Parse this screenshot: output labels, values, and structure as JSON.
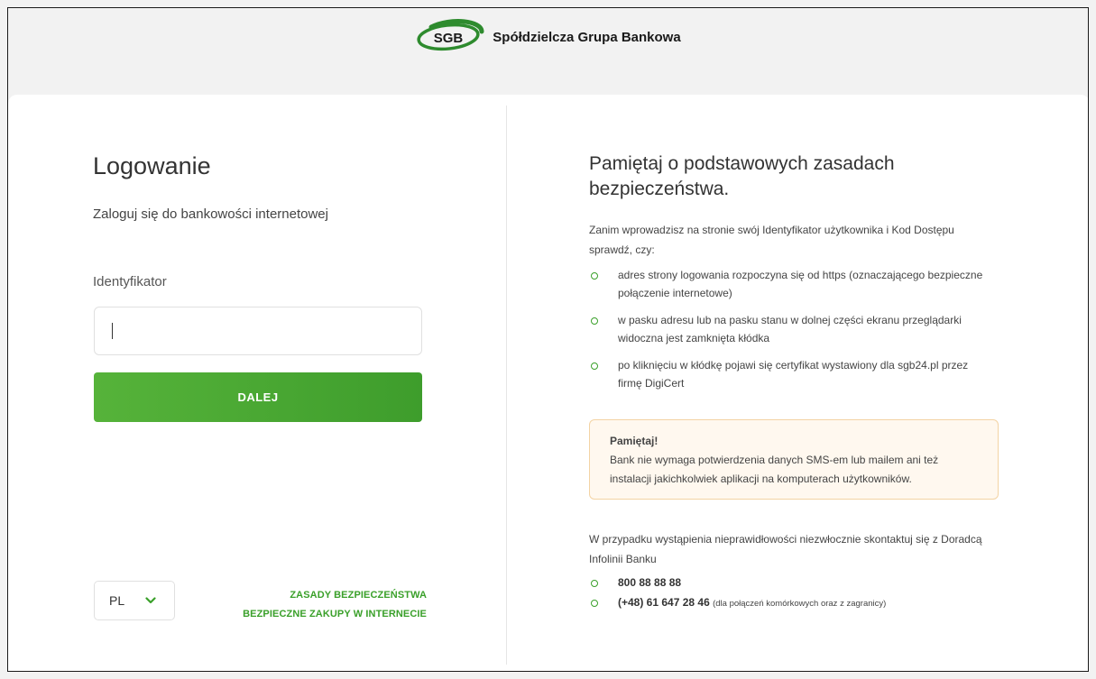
{
  "header": {
    "logo_text": "SGB",
    "bank_name": "Spółdzielcza Grupa Bankowa"
  },
  "login": {
    "title": "Logowanie",
    "subtitle": "Zaloguj się do bankowości internetowej",
    "id_label": "Identyfikator",
    "id_value": "",
    "next_button": "DALEJ"
  },
  "footer": {
    "language": "PL",
    "links": [
      "ZASADY BEZPIECZEŃSTWA",
      "BEZPIECZNE ZAKUPY W INTERNECIE"
    ]
  },
  "security": {
    "title": "Pamiętaj o podstawowych zasadach bezpieczeństwa.",
    "intro": "Zanim wprowadzisz na stronie swój Identyfikator użytkownika i Kod Dostępu sprawdź, czy:",
    "checks": [
      "adres strony logowania rozpoczyna się od https (oznaczającego bezpieczne połączenie internetowe)",
      "w pasku adresu lub na pasku stanu w dolnej części ekranu przeglądarki widoczna jest zamknięta kłódka",
      "po kliknięciu w kłódkę pojawi się certyfikat wystawiony dla sgb24.pl przez firmę DigiCert"
    ],
    "notice_title": "Pamiętaj!",
    "notice_body": "Bank nie wymaga potwierdzenia danych SMS-em lub mailem ani też instalacji jakichkolwiek aplikacji na komputerach użytkowników.",
    "contact_intro": "W przypadku wystąpienia nieprawidłowości niezwłocznie skontaktuj się z Doradcą Infolinii Banku",
    "phones": [
      {
        "number": "800 88 88 88",
        "note": ""
      },
      {
        "number": "(+48) 61 647 28 46",
        "note": "(dla połączeń komórkowych oraz z zagranicy)"
      }
    ]
  },
  "colors": {
    "accent_green": "#3aa02a",
    "notice_bg": "#fff8ef",
    "notice_border": "#f3d3a4"
  }
}
